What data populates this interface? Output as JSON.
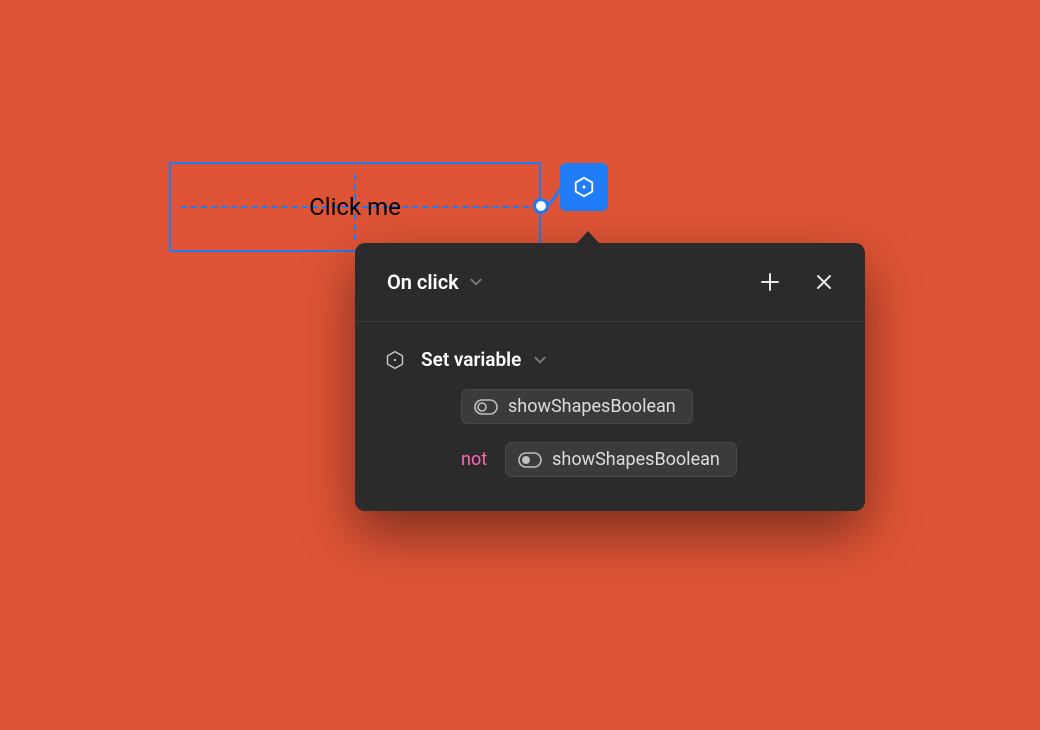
{
  "colors": {
    "canvas_bg": "#df5436",
    "selection": "#1f7bf6",
    "panel_bg": "#2b2b2b",
    "not_keyword": "#ff66b3"
  },
  "selected_element": {
    "label": "Click me"
  },
  "interaction_badge": {
    "icon": "hexagon-dot-icon"
  },
  "panel": {
    "header": {
      "trigger_label": "On click"
    },
    "action": {
      "icon": "hexagon-dot-icon",
      "label": "Set variable",
      "target_variable": "showShapesBoolean",
      "not_keyword": "not",
      "value_variable": "showShapesBoolean"
    }
  }
}
